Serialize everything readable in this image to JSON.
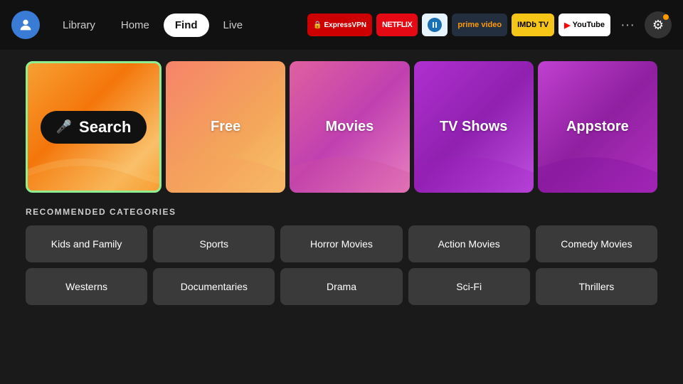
{
  "nav": {
    "library_label": "Library",
    "home_label": "Home",
    "find_label": "Find",
    "live_label": "Live"
  },
  "apps": [
    {
      "id": "expressvpn",
      "label": "ExpressVPN",
      "class": "badge-express"
    },
    {
      "id": "netflix",
      "label": "NETFLIX",
      "class": "badge-netflix"
    },
    {
      "id": "freefire",
      "label": "ff",
      "class": "badge-freefire"
    },
    {
      "id": "primevideo",
      "label": "prime video",
      "class": "badge-prime"
    },
    {
      "id": "imdbtv",
      "label": "IMDb TV",
      "class": "badge-imdb"
    },
    {
      "id": "youtube",
      "label": "▶ YouTube",
      "class": "badge-youtube"
    }
  ],
  "tiles": [
    {
      "id": "search",
      "label": "Search"
    },
    {
      "id": "free",
      "label": "Free"
    },
    {
      "id": "movies",
      "label": "Movies"
    },
    {
      "id": "tvshows",
      "label": "TV Shows"
    },
    {
      "id": "appstore",
      "label": "Appstore"
    }
  ],
  "recommended_label": "RECOMMENDED CATEGORIES",
  "categories_row1": [
    "Kids and Family",
    "Sports",
    "Horror Movies",
    "Action Movies",
    "Comedy Movies"
  ],
  "categories_row2": [
    "Westerns",
    "Documentaries",
    "Drama",
    "Sci-Fi",
    "Thrillers"
  ]
}
